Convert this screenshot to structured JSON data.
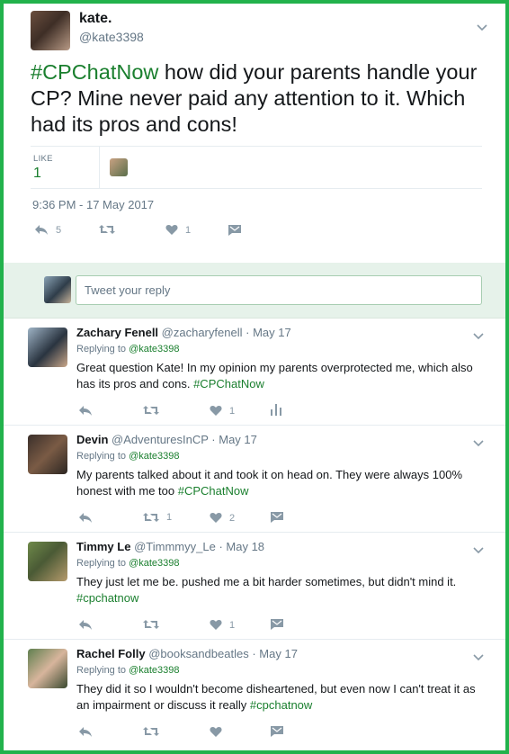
{
  "main_tweet": {
    "name": "kate.",
    "handle": "@kate3398",
    "hashtag": "#CPChatNow",
    "text": " how did your parents handle your CP? Mine never paid any attention to it. Which had its pros and cons!",
    "like_label": "LIKE",
    "like_count": "1",
    "timestamp": "9:36 PM - 17 May 2017",
    "reply_count": "5",
    "retweet_count": "",
    "heart_count": "1"
  },
  "reply_box": {
    "placeholder": "Tweet your reply"
  },
  "replies": [
    {
      "name": "Zachary Fenell",
      "handle": "@zacharyfenell",
      "date": "May 17",
      "replying_label": "Replying to ",
      "replying_to": "@kate3398",
      "text": "Great question Kate! In my opinion my parents overprotected me, which also has its pros and cons. ",
      "hashtag": "#CPChatNow",
      "retweets": "",
      "likes": "1",
      "last_action": "analytics-icon"
    },
    {
      "name": "Devin",
      "handle": "@AdventuresInCP",
      "date": "May 17",
      "replying_label": "Replying to ",
      "replying_to": "@kate3398",
      "text": "My parents talked about it and took it on head on. They were always 100% honest with me too ",
      "hashtag": "#CPChatNow",
      "retweets": "1",
      "likes": "2",
      "last_action": "message-icon"
    },
    {
      "name": "Timmy Le",
      "handle": "@Timmmyy_Le",
      "date": "May 18",
      "replying_label": "Replying to ",
      "replying_to": "@kate3398",
      "text": "They just let me be. pushed me a bit harder sometimes, but didn't mind it. ",
      "hashtag": "#cpchatnow",
      "retweets": "",
      "likes": "1",
      "last_action": "message-icon"
    },
    {
      "name": "Rachel Folly",
      "handle": "@booksandbeatles",
      "date": "May 17",
      "replying_label": "Replying to ",
      "replying_to": "@kate3398",
      "text": "They did it so I wouldn't become disheartened, but even now I can't treat it as an impairment or discuss it really ",
      "hashtag": "#cpchatnow",
      "retweets": "",
      "likes": "",
      "last_action": "message-icon"
    }
  ],
  "colors": {
    "frame": "#22b24c",
    "hashtag": "#1a7f2e",
    "muted": "#657786",
    "icon": "#8899a6"
  }
}
